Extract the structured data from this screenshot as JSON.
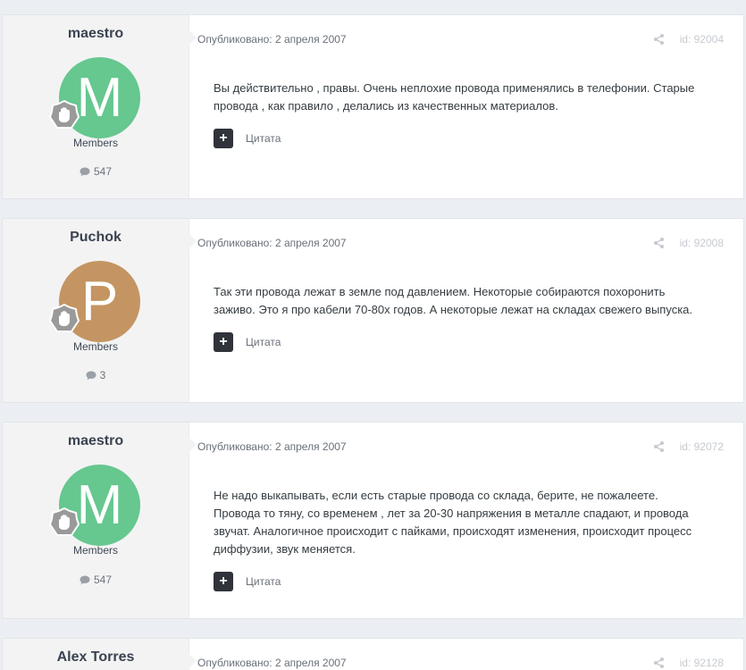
{
  "posts": [
    {
      "author": "maestro",
      "avatar_letter": "M",
      "avatar_color": "#66c78f",
      "group": "Members",
      "post_count": "547",
      "published": "Опубликовано: 2 апреля 2007",
      "post_id": "id: 92004",
      "text": "Вы действительно , правы. Очень неплохие провода применялись в телефонии. Старые провода , как правило , делались из качественных материалов.",
      "quote_label": "Цитата"
    },
    {
      "author": "Puchok",
      "avatar_letter": "P",
      "avatar_color": "#c49562",
      "group": "Members",
      "post_count": "3",
      "published": "Опубликовано: 2 апреля 2007",
      "post_id": "id: 92008",
      "text": "Так эти провода лежат в земле под давлением. Некоторые собираются похоронить заживо. Это я про кабели 70-80х годов. А некоторые лежат на складах свежего выпуска.",
      "quote_label": "Цитата"
    },
    {
      "author": "maestro",
      "avatar_letter": "M",
      "avatar_color": "#66c78f",
      "group": "Members",
      "post_count": "547",
      "published": "Опубликовано: 2 апреля 2007",
      "post_id": "id: 92072",
      "text": "Не надо выкапывать, если есть старые провода со склада, берите, не пожалеете. Провода то тяну, со временем , лет за 20-30 напряжения в металле спадают, и провода звучат. Аналогичное происходит с пайками, происходят изменения, происходит процесс диффузии, звук меняется.",
      "quote_label": "Цитата"
    },
    {
      "author": "Alex Torres",
      "published": "Опубликовано: 2 апреля 2007",
      "post_id": "id: 92128"
    }
  ],
  "colors": {
    "page_bg": "#ebeef2",
    "author_panel_bg": "#f3f3f4",
    "button_dark": "#30333a",
    "muted_text": "#6a7079"
  },
  "icons": {
    "rank_badge": "hand-badge-icon",
    "post_count": "speech-bubble-icon",
    "share": "share-icon",
    "multiquote": "plus-icon"
  }
}
